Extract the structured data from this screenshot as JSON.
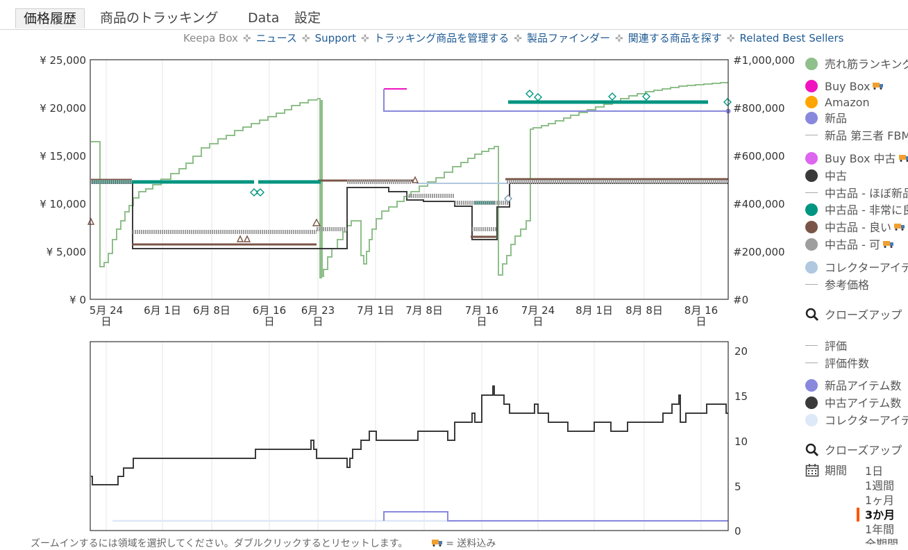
{
  "tabs": [
    {
      "label": "価格履歴",
      "active": true
    },
    {
      "label": "商品のトラッキング",
      "active": false
    },
    {
      "label": "Data",
      "active": false
    },
    {
      "label": "設定",
      "active": false
    }
  ],
  "links": {
    "brand": "Keepa Box",
    "items": [
      "ニュース",
      "Support",
      "トラッキング商品を管理する",
      "製品ファインダー",
      "関連する商品を探す",
      "Related Best Sellers"
    ]
  },
  "price_chart": {
    "y_left_ticks": [
      "¥ 25,000",
      "¥ 20,000",
      "¥ 15,000",
      "¥ 10,000",
      "¥ 5,000",
      "¥ 0"
    ],
    "y_right_ticks": [
      "#1,000,000",
      "#800,000",
      "#600,000",
      "#400,000",
      "#200,000",
      "#0"
    ],
    "x_ticks": [
      {
        "line1": "5月 24",
        "line2": "日"
      },
      {
        "line1": "6月 1日",
        "line2": ""
      },
      {
        "line1": "6月 8日",
        "line2": ""
      },
      {
        "line1": "6月 16",
        "line2": "日"
      },
      {
        "line1": "6月 23",
        "line2": "日"
      },
      {
        "line1": "7月 1日",
        "line2": ""
      },
      {
        "line1": "7月 8日",
        "line2": ""
      },
      {
        "line1": "7月 16",
        "line2": "日"
      },
      {
        "line1": "7月 24",
        "line2": "日"
      },
      {
        "line1": "8月 1日",
        "line2": ""
      },
      {
        "line1": "8月 8日",
        "line2": ""
      },
      {
        "line1": "8月 16",
        "line2": "日"
      }
    ]
  },
  "count_chart": {
    "y_right_ticks": [
      "20",
      "15",
      "10",
      "5",
      "0"
    ]
  },
  "legend": {
    "items": [
      {
        "label": "売れ筋ランキング",
        "color": "#8fbf8a",
        "kind": "dot",
        "truck": false
      },
      {
        "label": "Buy Box",
        "color": "#f012be",
        "kind": "dot",
        "truck": true
      },
      {
        "label": "Amazon",
        "color": "#ffa500",
        "kind": "dot",
        "truck": false
      },
      {
        "label": "新品",
        "color": "#8888dd",
        "kind": "dot",
        "truck": false
      },
      {
        "label": "新品 第三者 FBM",
        "color": "#aaaaaa",
        "kind": "dash",
        "truck": false
      },
      {
        "label": "Buy Box 中古",
        "color": "#dd66ee",
        "kind": "dot",
        "truck": true
      },
      {
        "label": "中古",
        "color": "#3a3a3a",
        "kind": "dot",
        "truck": false
      },
      {
        "label": "中古品 - ほぼ新品",
        "color": "#aaaaaa",
        "kind": "dash",
        "truck": false
      },
      {
        "label": "中古品 - 非常に良い",
        "color": "#009580",
        "kind": "dot",
        "truck": false
      },
      {
        "label": "中古品 - 良い",
        "color": "#7a5547",
        "kind": "dot",
        "truck": true
      },
      {
        "label": "中古品 - 可",
        "color": "#9e9e9e",
        "kind": "dot",
        "truck": true
      },
      {
        "label": "コレクターアイテム",
        "color": "#b0c8e0",
        "kind": "dot",
        "truck": false
      },
      {
        "label": "参考価格",
        "color": "#aaaaaa",
        "kind": "dash",
        "truck": false
      }
    ],
    "closeup": "クローズアップ",
    "items2": [
      {
        "label": "評価",
        "color": "#aaaaaa",
        "kind": "dash"
      },
      {
        "label": "評価件数",
        "color": "#aaaaaa",
        "kind": "dash"
      },
      {
        "label": "新品アイテム数",
        "color": "#8888dd",
        "kind": "dot"
      },
      {
        "label": "中古アイテム数",
        "color": "#3a3a3a",
        "kind": "dot"
      },
      {
        "label": "コレクターアイテム数",
        "color": "#dde8f8",
        "kind": "dot"
      }
    ],
    "closeup2": "クローズアップ",
    "period_label": "期間",
    "periods": [
      "1日",
      "1週間",
      "1ヶ月",
      "3か月",
      "1年間",
      "全期間"
    ],
    "selected_period": "3か月"
  },
  "footer": {
    "hint": "ズームインするには領域を選択してください。ダブルクリックするとリセットします。",
    "shipping": "= 送料込み"
  }
}
